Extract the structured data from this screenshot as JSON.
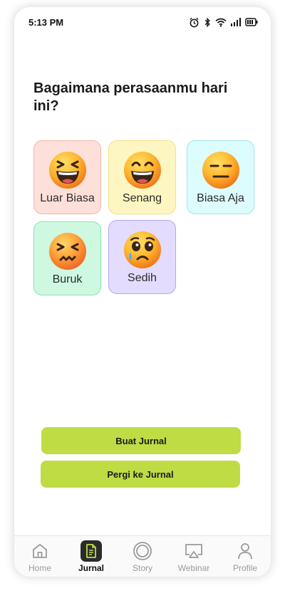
{
  "status_bar": {
    "time": "5:13 PM",
    "icons": [
      "alarm-icon",
      "bluetooth-icon",
      "wifi-icon",
      "signal-icon",
      "battery-icon"
    ]
  },
  "question": "Bagaimana perasaanmu hari ini?",
  "moods": [
    {
      "label": "Luar Biasa",
      "icon": "laughing-face-icon",
      "color": "#fde0d9",
      "border": "#f3b8ab"
    },
    {
      "label": "Senang",
      "icon": "grinning-face-icon",
      "color": "#fef6c2",
      "border": "#f2df7e"
    },
    {
      "label": "Biasa Aja",
      "icon": "expressionless-face-icon",
      "color": "#dcfcfd",
      "border": "#9fe6ea"
    },
    {
      "label": "Buruk",
      "icon": "confounded-face-icon",
      "color": "#cff8e1",
      "border": "#8fe0b2"
    },
    {
      "label": "Sedih",
      "icon": "crying-face-icon",
      "color": "#e3dcff",
      "border": "#b5a6ee"
    }
  ],
  "buttons": {
    "create_journal": "Buat Jurnal",
    "go_to_journal": "Pergi ke Jurnal",
    "color": "#bfdc45"
  },
  "nav": [
    {
      "label": "Home",
      "icon": "home-icon",
      "active": false
    },
    {
      "label": "Jurnal",
      "icon": "journal-icon",
      "active": true
    },
    {
      "label": "Story",
      "icon": "story-icon",
      "active": false
    },
    {
      "label": "Webinar",
      "icon": "webinar-icon",
      "active": false
    },
    {
      "label": "Profile",
      "icon": "profile-icon",
      "active": false
    }
  ]
}
